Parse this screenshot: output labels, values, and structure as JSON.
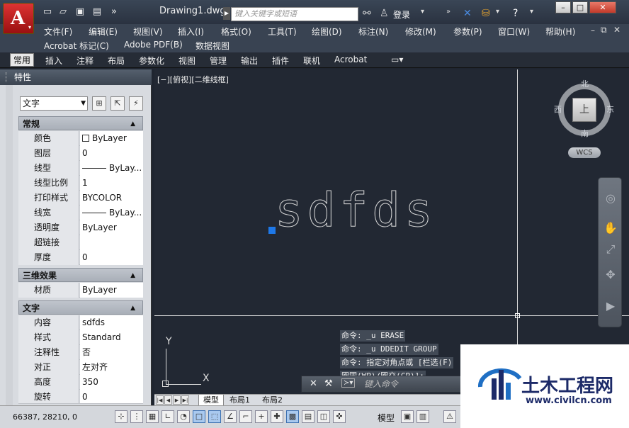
{
  "titlebar": {
    "doc_title": "Drawing1.dwg",
    "search_placeholder": "键入关键字或短语",
    "login_label": "登录"
  },
  "menu": {
    "items": [
      "文件(F)",
      "编辑(E)",
      "视图(V)",
      "插入(I)",
      "格式(O)",
      "工具(T)",
      "绘图(D)",
      "标注(N)",
      "修改(M)",
      "参数(P)",
      "窗口(W)",
      "帮助(H)"
    ],
    "row2": [
      "Acrobat 标记(C)",
      "Adobe PDF(B)",
      "数据视图"
    ]
  },
  "ribbon": {
    "tabs": [
      "常用",
      "插入",
      "注释",
      "布局",
      "参数化",
      "视图",
      "管理",
      "输出",
      "插件",
      "联机",
      "Acrobat"
    ],
    "active_tab": "常用"
  },
  "palette": {
    "title": "特性",
    "object_type": "文字",
    "sections": {
      "general": {
        "title": "常规",
        "rows": [
          {
            "name": "颜色",
            "value": "ByLayer"
          },
          {
            "name": "图层",
            "value": "0"
          },
          {
            "name": "线型",
            "value": "ByLay..."
          },
          {
            "name": "线型比例",
            "value": "1"
          },
          {
            "name": "打印样式",
            "value": "BYCOLOR"
          },
          {
            "name": "线宽",
            "value": "ByLay..."
          },
          {
            "name": "透明度",
            "value": "ByLayer"
          },
          {
            "name": "超链接",
            "value": ""
          },
          {
            "name": "厚度",
            "value": "0"
          }
        ]
      },
      "three_d": {
        "title": "三维效果",
        "rows": [
          {
            "name": "材质",
            "value": "ByLayer"
          }
        ]
      },
      "text": {
        "title": "文字",
        "rows": [
          {
            "name": "内容",
            "value": "sdfds"
          },
          {
            "name": "样式",
            "value": "Standard"
          },
          {
            "name": "注释性",
            "value": "否"
          },
          {
            "name": "对正",
            "value": "左对齐"
          },
          {
            "name": "高度",
            "value": "350"
          },
          {
            "name": "旋转",
            "value": "0"
          }
        ]
      }
    }
  },
  "canvas": {
    "view_label": "[−][俯视][二维线框]",
    "drawn_text": "sdfds",
    "viewcube": {
      "north": "北",
      "south": "南",
      "east": "东",
      "west": "西",
      "face": "上",
      "wcs": "WCS"
    },
    "ucs": {
      "x": "X",
      "y": "Y"
    }
  },
  "command": {
    "history": [
      "命令: _u ERASE",
      "命令: _u DDEDIT GROUP",
      "命令: 指定对角点或 [栏选(F)",
      "圈围(WP)/圈交(CP)]:"
    ],
    "input_placeholder": "键入命令"
  },
  "layout_tabs": [
    "模型",
    "布局1",
    "布局2"
  ],
  "status": {
    "coords": "66387, 28210, 0",
    "model_label": "模型"
  },
  "watermark": {
    "title": "土木工程网",
    "url": "www.civilcn.com"
  }
}
